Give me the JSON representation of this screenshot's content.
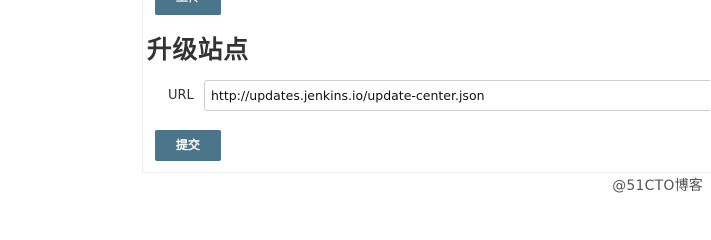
{
  "top_button": {
    "label": "上传"
  },
  "section": {
    "title": "升级站点"
  },
  "url_field": {
    "label": "URL",
    "value": "http://updates.jenkins.io/update-center.json"
  },
  "submit_button": {
    "label": "提交"
  },
  "watermark": {
    "text": "@51CTO博客"
  },
  "colors": {
    "button_bg": "#4b758b",
    "button_text": "#ffffff",
    "heading_text": "#333333",
    "input_border": "#cccccc"
  }
}
